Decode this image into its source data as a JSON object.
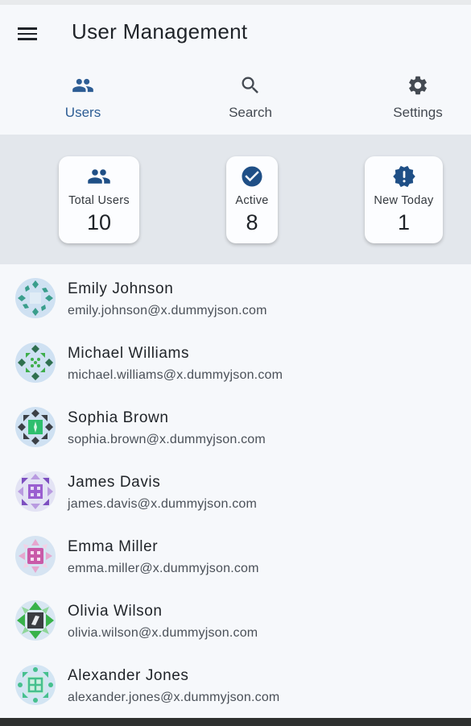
{
  "app": {
    "title": "User Management",
    "menu_icon": "menu-icon"
  },
  "tabs": [
    {
      "label": "Users",
      "icon": "people-icon",
      "active": true
    },
    {
      "label": "Search",
      "icon": "search-icon",
      "active": false
    },
    {
      "label": "Settings",
      "icon": "gear-icon",
      "active": false
    }
  ],
  "stats": [
    {
      "label": "Total Users",
      "value": "10",
      "icon": "people-icon"
    },
    {
      "label": "Active",
      "value": "8",
      "icon": "check-circle-icon"
    },
    {
      "label": "New Today",
      "value": "1",
      "icon": "new-badge-icon"
    }
  ],
  "users": [
    {
      "name": "Emily Johnson",
      "email": "emily.johnson@x.dummyjson.com",
      "avatar_color": "#3a9e8c"
    },
    {
      "name": "Michael Williams",
      "email": "michael.williams@x.dummyjson.com",
      "avatar_color": "#3fae4c"
    },
    {
      "name": "Sophia Brown",
      "email": "sophia.brown@x.dummyjson.com",
      "avatar_color": "#2fbf6e"
    },
    {
      "name": "James Davis",
      "email": "james.davis@x.dummyjson.com",
      "avatar_color": "#9a5fd0"
    },
    {
      "name": "Emma Miller",
      "email": "emma.miller@x.dummyjson.com",
      "avatar_color": "#c95aa8"
    },
    {
      "name": "Olivia Wilson",
      "email": "olivia.wilson@x.dummyjson.com",
      "avatar_color": "#38b24a"
    },
    {
      "name": "Alexander Jones",
      "email": "alexander.jones@x.dummyjson.com",
      "avatar_color": "#46c08e"
    }
  ],
  "colors": {
    "accent": "#2d5d94",
    "stat_icon": "#1f4f86"
  }
}
